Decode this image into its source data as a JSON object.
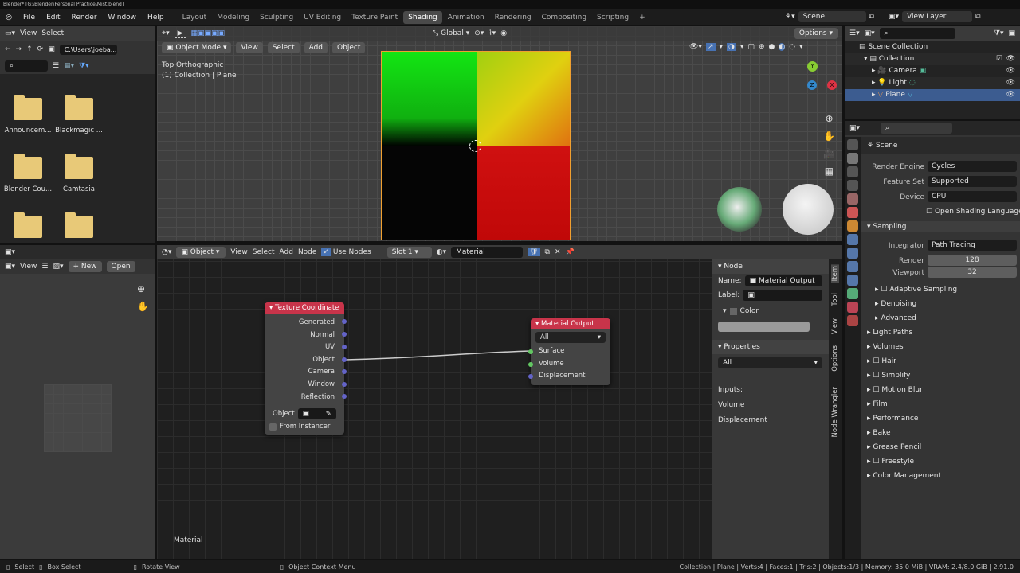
{
  "window": {
    "title": "Blender* [G:\\Blender\\Personal Practice\\Mist.blend]"
  },
  "menu": [
    "File",
    "Edit",
    "Render",
    "Window",
    "Help"
  ],
  "workspaces": [
    "Layout",
    "Modeling",
    "Sculpting",
    "UV Editing",
    "Texture Paint",
    "Shading",
    "Animation",
    "Rendering",
    "Compositing",
    "Scripting"
  ],
  "active_workspace": "Shading",
  "scene": {
    "name": "Scene",
    "view_layer": "View Layer"
  },
  "file_browser": {
    "menu": [
      "View",
      "Select"
    ],
    "path": "C:\\Users\\joeba...",
    "items": [
      "Announcem...",
      "Blackmagic ...",
      "Blender Cou...",
      "Camtasia",
      "",
      ""
    ]
  },
  "image_editor": {
    "view": "View",
    "new": "New",
    "open": "Open"
  },
  "viewport": {
    "orientation": "Global",
    "options": "Options",
    "mode": "Object Mode",
    "menu": [
      "View",
      "Select",
      "Add",
      "Object"
    ],
    "view_name": "Top Orthographic",
    "collection_info": "(1) Collection | Plane",
    "gizmo": {
      "x": "X",
      "y": "Y",
      "z": "Z"
    }
  },
  "node_editor": {
    "type": "Object",
    "menu": [
      "View",
      "Select",
      "Add",
      "Node"
    ],
    "use_nodes": "Use Nodes",
    "slot": "Slot 1",
    "material": "Material",
    "footer": "Material",
    "tex_coord": {
      "title": "Texture Coordinate",
      "outputs": [
        "Generated",
        "Normal",
        "UV",
        "Object",
        "Camera",
        "Window",
        "Reflection"
      ],
      "object_label": "Object",
      "from_instancer": "From Instancer"
    },
    "mat_output": {
      "title": "Material Output",
      "target": "All",
      "inputs": [
        "Surface",
        "Volume",
        "Displacement"
      ]
    }
  },
  "npanel": {
    "tabs": [
      "Item",
      "Tool",
      "View",
      "Options",
      "Node Wrangler"
    ],
    "node_header": "Node",
    "name_label": "Name:",
    "name_value": "Material Output",
    "label_label": "Label:",
    "color_label": "Color",
    "properties_header": "Properties",
    "target": "All",
    "inputs_label": "Inputs:",
    "inputs": [
      "Volume",
      "Displacement"
    ]
  },
  "outliner": {
    "root": "Scene Collection",
    "collection": "Collection",
    "items": [
      "Camera",
      "Light",
      "Plane"
    ],
    "selected": "Plane"
  },
  "properties": {
    "scene": "Scene",
    "render_engine_label": "Render Engine",
    "render_engine": "Cycles",
    "feature_set_label": "Feature Set",
    "feature_set": "Supported",
    "device_label": "Device",
    "device": "CPU",
    "osl": "Open Shading Language",
    "sampling": "Sampling",
    "integrator_label": "Integrator",
    "integrator": "Path Tracing",
    "render_label": "Render",
    "render_samples": "128",
    "viewport_label": "Viewport",
    "viewport_samples": "32",
    "subsections": [
      "Adaptive Sampling",
      "Denoising",
      "Advanced"
    ],
    "sections": [
      "Light Paths",
      "Volumes",
      "Hair",
      "Simplify",
      "Motion Blur",
      "Film",
      "Performance",
      "Bake",
      "Grease Pencil",
      "Freestyle",
      "Color Management"
    ]
  },
  "statusbar": {
    "select": "Select",
    "box_select": "Box Select",
    "rotate": "Rotate View",
    "context": "Object Context Menu",
    "stats": "Collection | Plane | Verts:4 | Faces:1 | Tris:2 | Objects:1/3 | Memory: 35.0 MiB | VRAM: 2.4/8.0 GiB | 2.91.0"
  },
  "colors": {
    "accent": "#4772b3",
    "node_header": "#c8344a",
    "socket_vector": "#6363c7",
    "socket_shader": "#63c763"
  }
}
